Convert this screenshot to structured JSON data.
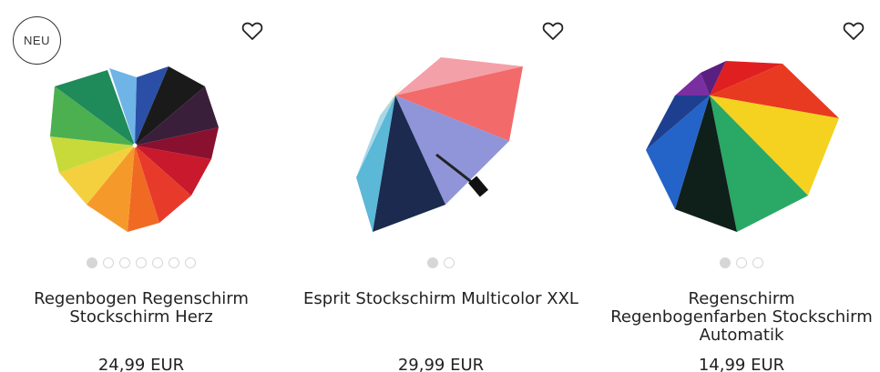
{
  "products": [
    {
      "badge": "NEU",
      "name": "Regenbogen Regenschirm Stockschirm Herz",
      "price": "24,99 EUR",
      "image_icon": "heart-rainbow-umbrella",
      "dots": 7,
      "active_dot": 0
    },
    {
      "name": "Esprit Stockschirm Multicolor XXL",
      "price": "29,99 EUR",
      "image_icon": "esprit-multicolor-umbrella",
      "dots": 2,
      "active_dot": 0
    },
    {
      "name": "Regenschirm Regenbogenfarben Stockschirm Automatik",
      "price": "14,99 EUR",
      "image_icon": "rainbow-automatic-umbrella",
      "dots": 3,
      "active_dot": 0
    }
  ],
  "colors": {
    "text": "#222222",
    "dot_border": "#d6d6d6",
    "dot_active": "#d6d6d6"
  }
}
